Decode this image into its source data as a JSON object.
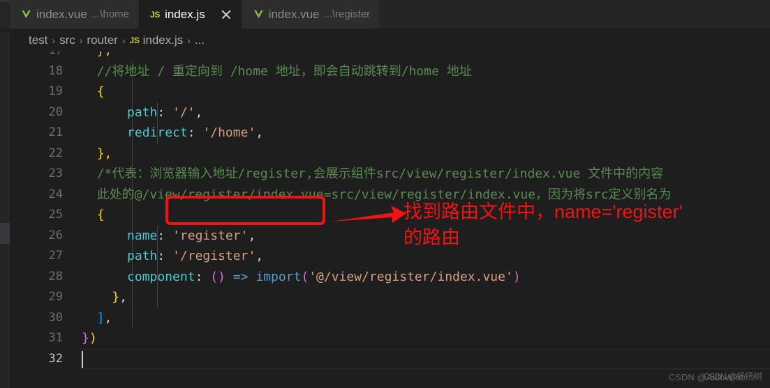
{
  "window": {
    "background": "#1e1e1e",
    "accent_red": "#f21414",
    "comment_green": "#5a8a52"
  },
  "tabs": [
    {
      "name": "index.vue",
      "path": "...\\home",
      "icon": "vue-icon",
      "active": false,
      "closable": false
    },
    {
      "name": "index.js",
      "path": "",
      "icon": "js-icon",
      "active": true,
      "closable": true
    },
    {
      "name": "index.vue",
      "path": "...\\register",
      "icon": "vue-icon",
      "active": false,
      "closable": false
    }
  ],
  "breadcrumb": {
    "items": [
      "test",
      "src",
      "router"
    ],
    "file": "index.js",
    "file_icon": "js-icon",
    "tail": "...",
    "separator": "›"
  },
  "editor": {
    "language": "javascript",
    "active_line": 32,
    "lines": [
      {
        "number": 18,
        "text": "//将地址 / 重定向到 /home 地址，即会自动跳转到/home 地址"
      },
      {
        "number": 19,
        "text": "{"
      },
      {
        "number": 20,
        "text": "path: '/',"
      },
      {
        "number": 21,
        "text": "redirect: '/home',"
      },
      {
        "number": 22,
        "text": "},"
      },
      {
        "number": 23,
        "text": "/*代表：浏览器输入地址/register,会展示组件src/view/register/index.vue 文件中的内容"
      },
      {
        "number": 24,
        "text": "此处的@/view/register/index.vue=src/view/register/index.vue，因为将src定义别名为"
      },
      {
        "number": 25,
        "text": "{"
      },
      {
        "number": 26,
        "text": "name: 'register',"
      },
      {
        "number": 27,
        "text": "path: '/register',"
      },
      {
        "number": 28,
        "text": "component: () => import('@/view/register/index.vue')"
      },
      {
        "number": 29,
        "text": "},"
      },
      {
        "number": 30,
        "text": "],"
      },
      {
        "number": 31,
        "text": "})"
      },
      {
        "number": 32,
        "text": ""
      }
    ],
    "tokens": {
      "l18_comment": "//将地址 / 重定向到 /home 地址，即会自动跳转到/home 地址",
      "l19_brace": "{",
      "l20_prop": "path",
      "l20_colon": ":",
      "l20_value": "'/'",
      "l20_comma": ",",
      "l21_prop": "redirect",
      "l21_colon": ":",
      "l21_value": "'/home'",
      "l21_comma": ",",
      "l22_text": "},",
      "l23_comment": "/*代表：浏览器输入地址/register,会展示组件src/view/register/index.vue 文件中的内容",
      "l24_comment": "此处的@/view/register/index.vue=src/view/register/index.vue，因为将src定义别名为",
      "l25_brace": "{",
      "l26_prop": "name",
      "l26_colon": ":",
      "l26_value": "'register'",
      "l26_comma": ",",
      "l27_prop": "path",
      "l27_colon": ":",
      "l27_value": "'/register'",
      "l27_comma": ",",
      "l28_prop": "component",
      "l28_colon": ":",
      "l28_parens": "()",
      "l28_arrow": "=>",
      "l28_import": "import",
      "l28_open": "(",
      "l28_path": "'@/view/register/index.vue'",
      "l28_close": ")",
      "l29_brace": "}",
      "l29_comma": ",",
      "l30_bracket": "]",
      "l30_comma": ",",
      "l31_brace": "}",
      "l31_paren": ")"
    }
  },
  "annotation": {
    "highlight_label": "name: 'register'",
    "arrow": "right-arrow",
    "text_line1": "找到路由文件中，name='register'",
    "text_line2": "的路由",
    "color": "#f21414"
  },
  "watermark": {
    "text_a": "CSDN @AutoWire",
    "text_b": "CSDN @扬扬树"
  }
}
